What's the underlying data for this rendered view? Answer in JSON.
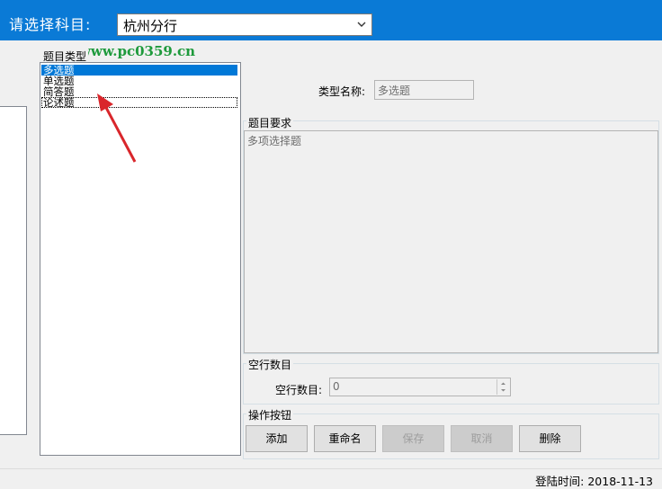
{
  "header": {
    "subject_label": "请选择科目:",
    "subject_value": "杭州分行"
  },
  "watermark": "www.pc0359.cn",
  "type_group": {
    "title": "题目类型",
    "items": [
      "多选题",
      "单选题",
      "简答题",
      "论述题"
    ],
    "selected_index": 0
  },
  "type_name": {
    "label": "类型名称:",
    "value": "多选题"
  },
  "requirements": {
    "title": "题目要求",
    "value": "多项选择题"
  },
  "blank_rows": {
    "title": "空行数目",
    "label": "空行数目:",
    "value": "0"
  },
  "actions": {
    "title": "操作按钮",
    "add": "添加",
    "rename": "重命名",
    "save": "保存",
    "cancel": "取消",
    "delete": "删除"
  },
  "status": {
    "login_time": "登陆时间:  2018-11-13"
  },
  "colors": {
    "header_bg": "#0a7ad6",
    "selection": "#0078d7",
    "annotation_arrow": "#d9262b"
  }
}
